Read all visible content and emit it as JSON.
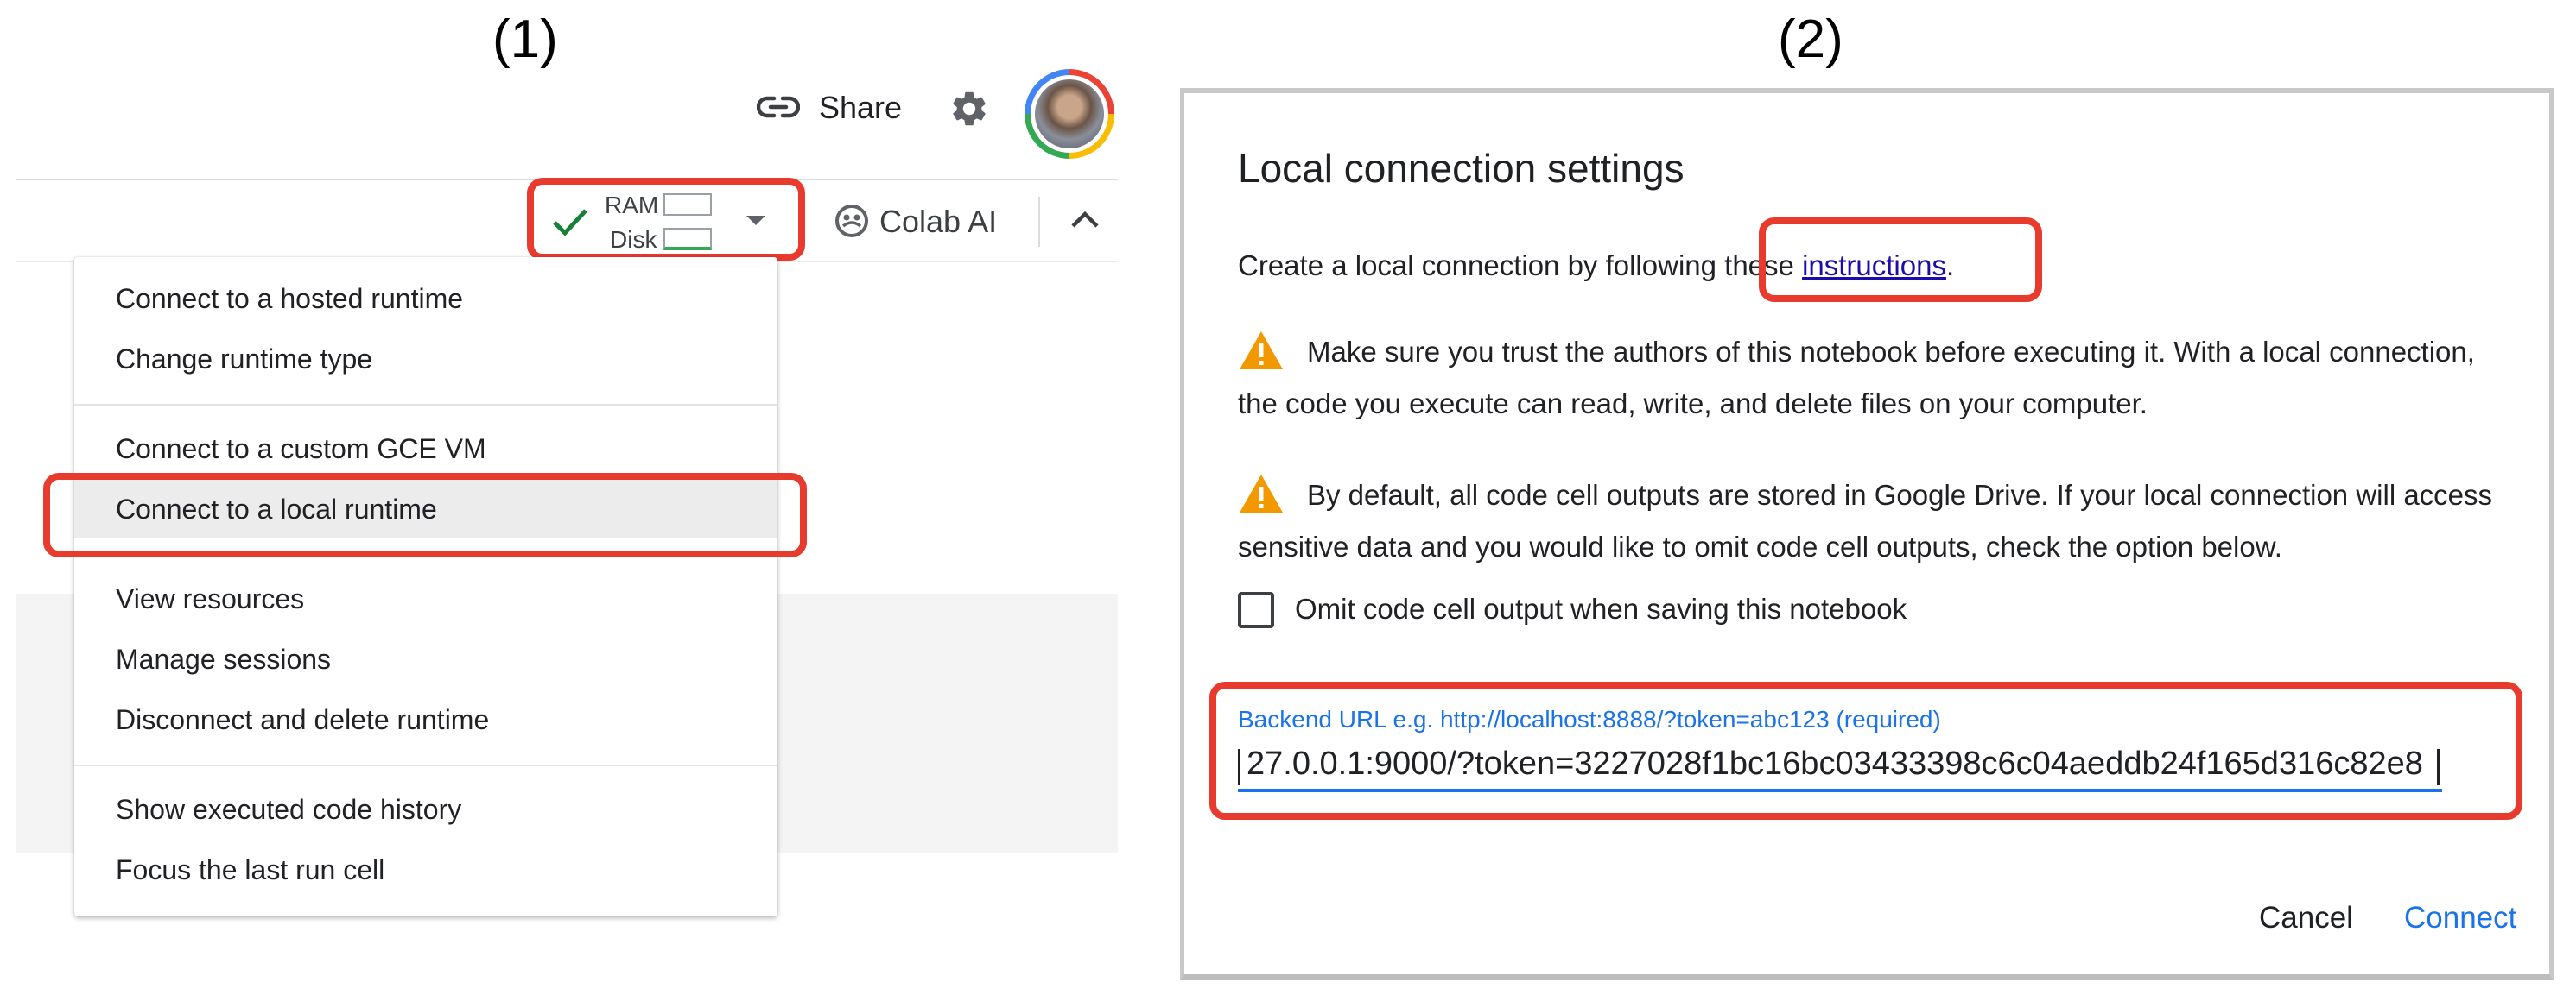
{
  "panels": {
    "left_label": "(1)",
    "right_label": "(2)"
  },
  "toolbar": {
    "share_label": "Share",
    "ram_label": "RAM",
    "disk_label": "Disk",
    "colab_ai_label": "Colab AI"
  },
  "runtime_menu": {
    "items": [
      "Connect to a hosted runtime",
      "Change runtime type",
      "Connect to a custom GCE VM",
      "Connect to a local runtime",
      "View resources",
      "Manage sessions",
      "Disconnect and delete runtime",
      "Show executed code history",
      "Focus the last run cell"
    ],
    "highlighted_item": "Connect to a local runtime"
  },
  "dialog": {
    "title": "Local connection settings",
    "intro_prefix": "Create a local connection by following these ",
    "intro_link": "instructions",
    "intro_suffix": ".",
    "warning_1": "Make sure you trust the authors of this notebook before executing it. With a local connection, the code you execute can read, write, and delete files on your computer.",
    "warning_2": "By default, all code cell outputs are stored in Google Drive. If your local connection will access sensitive data and you would like to omit code cell outputs, check the option below.",
    "omit_checkbox_label": "Omit code cell output when saving this notebook",
    "omit_checked": false,
    "backend_url_label": "Backend URL e.g. http://localhost:8888/?token=abc123 (required)",
    "backend_url_value": "27.0.0.1:9000/?token=3227028f1bc16bc03433398c6c04aeddb24f165d316c82e8",
    "cancel_label": "Cancel",
    "connect_label": "Connect"
  },
  "colors": {
    "accent": "#1a73e8",
    "highlight": "#e83a2d",
    "warning": "#f29900",
    "check": "#188038"
  }
}
